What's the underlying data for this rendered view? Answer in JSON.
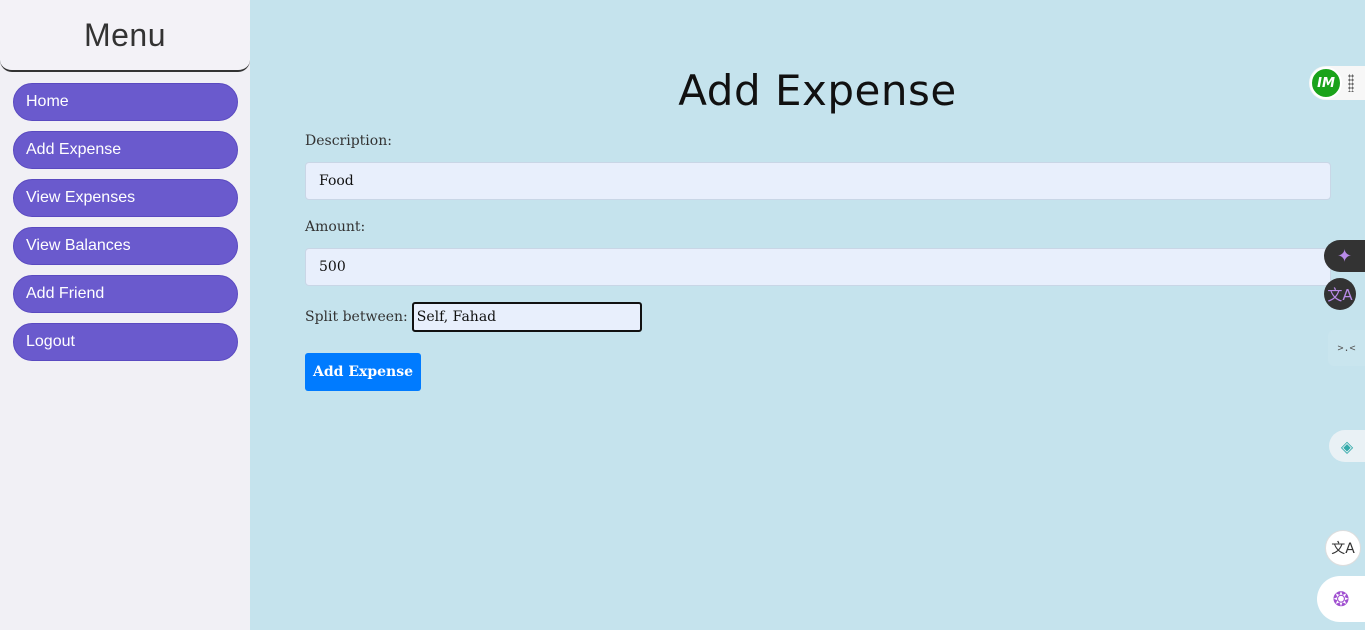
{
  "sidebar": {
    "title": "Menu",
    "items": [
      {
        "label": "Home"
      },
      {
        "label": "Add Expense"
      },
      {
        "label": "View Expenses"
      },
      {
        "label": "View Balances"
      },
      {
        "label": "Add Friend"
      },
      {
        "label": "Logout"
      }
    ]
  },
  "main": {
    "title": "Add Expense",
    "description": {
      "label": "Description:",
      "value": "Food"
    },
    "amount": {
      "label": "Amount:",
      "value": "500"
    },
    "split": {
      "label": "Split between:",
      "value": "Self, Fahad"
    },
    "submit_label": "Add Expense"
  },
  "extensions": {
    "im_badge": "IM",
    "translate_glyph": "文A",
    "face_glyph": ">.<"
  },
  "colors": {
    "background": "#c5e3ed",
    "sidebar_bg": "#f1f0f5",
    "nav_item": "#6a5acd",
    "primary_button": "#007bff",
    "input_bg": "#e8effc"
  }
}
